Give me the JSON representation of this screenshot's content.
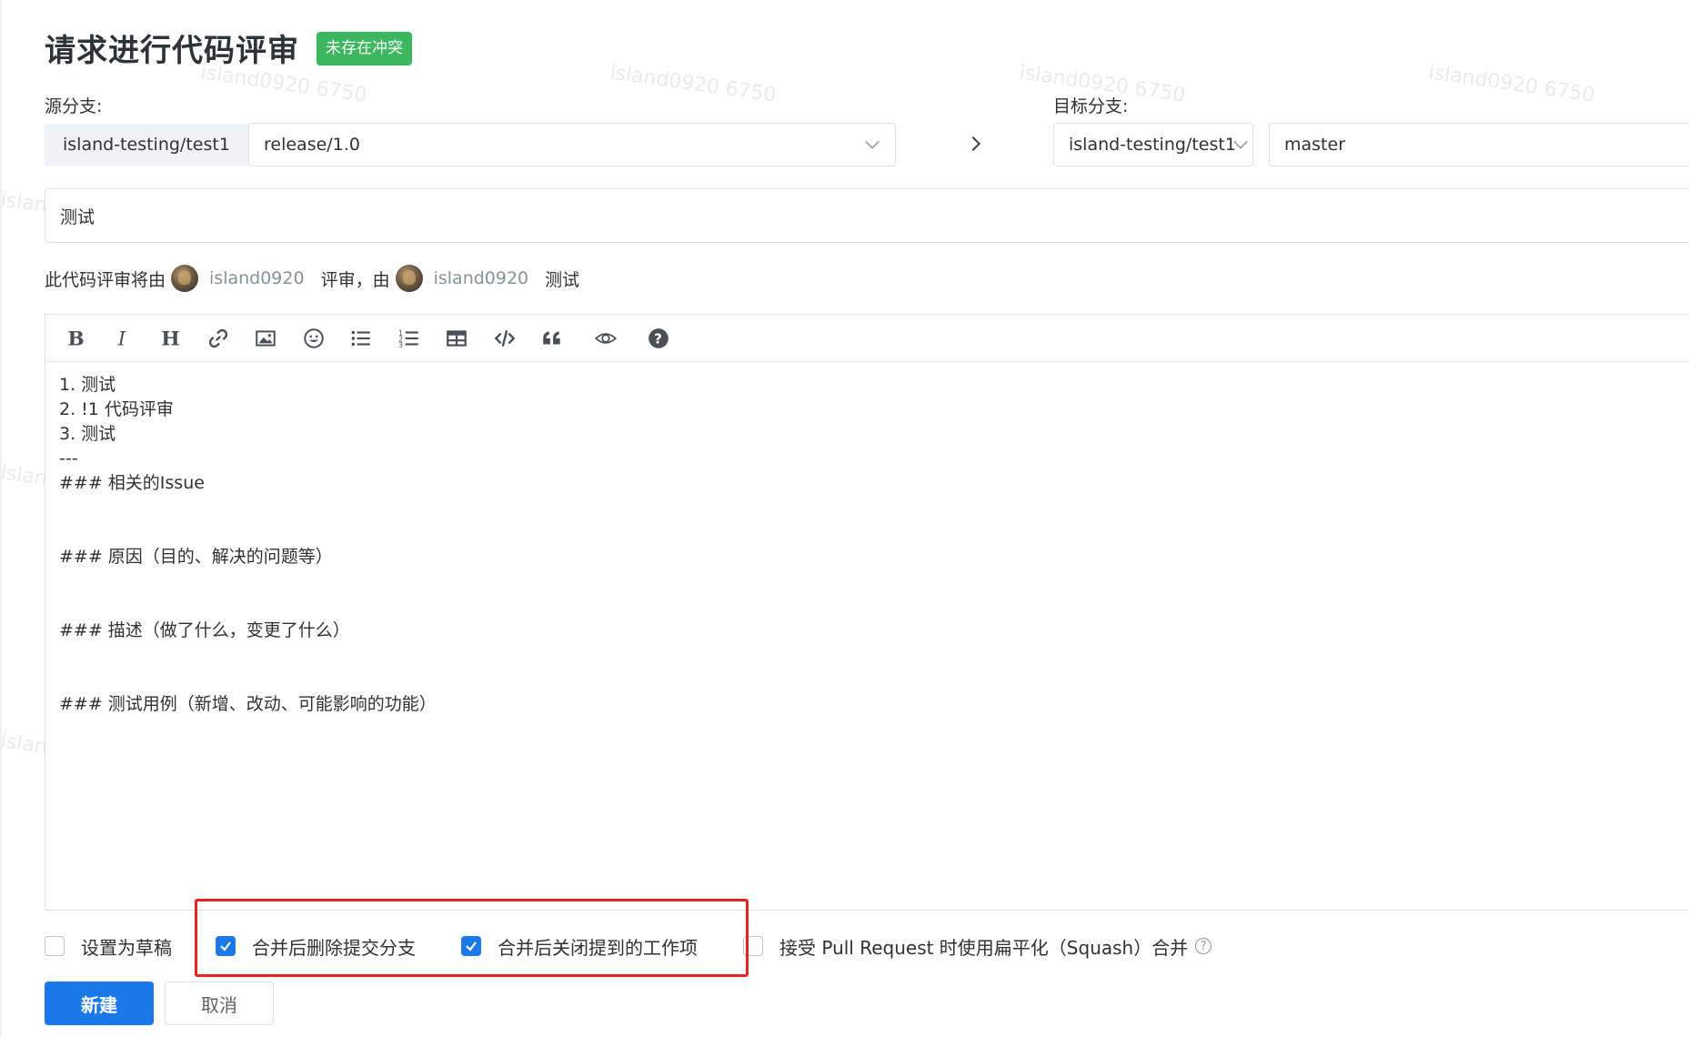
{
  "header": {
    "title": "请求进行代码评审",
    "status_badge": "未存在冲突",
    "badge_color": "#3cb75f"
  },
  "source": {
    "label": "源分支:",
    "repo": "island-testing/test1",
    "branch": "release/1.0"
  },
  "target": {
    "label": "目标分支:",
    "repo": "island-testing/test1",
    "branch": "master"
  },
  "title_input": {
    "value": "测试"
  },
  "reviewer_line": {
    "prefix": "此代码评审将由",
    "reviewer": "island0920",
    "middle": "评审，由",
    "author": "island0920",
    "suffix": "测试"
  },
  "toolbar": {
    "icons": [
      "bold-icon",
      "italic-icon",
      "heading-icon",
      "link-icon",
      "image-icon",
      "emoji-icon",
      "unordered-list-icon",
      "ordered-list-icon",
      "table-icon",
      "code-icon",
      "quote-icon",
      "preview-icon",
      "help-icon"
    ]
  },
  "editor": {
    "content": "1. 测试\n2. !1 代码评审\n3. 测试\n---\n### 相关的Issue\n\n\n### 原因（目的、解决的问题等）\n\n\n### 描述（做了什么，变更了什么）\n\n\n### 测试用例（新增、改动、可能影响的功能）"
  },
  "options": {
    "draft": {
      "label": "设置为草稿",
      "checked": false
    },
    "delete_branch": {
      "label": "合并后删除提交分支",
      "checked": true
    },
    "close_issues": {
      "label": "合并后关闭提到的工作项",
      "checked": true
    },
    "squash": {
      "label": "接受 Pull Request 时使用扁平化（Squash）合并",
      "checked": false
    }
  },
  "buttons": {
    "create": "新建",
    "cancel": "取消"
  },
  "watermark": "island0920 6750",
  "colors": {
    "primary": "#1a78e8",
    "highlight": "#e8231f"
  }
}
